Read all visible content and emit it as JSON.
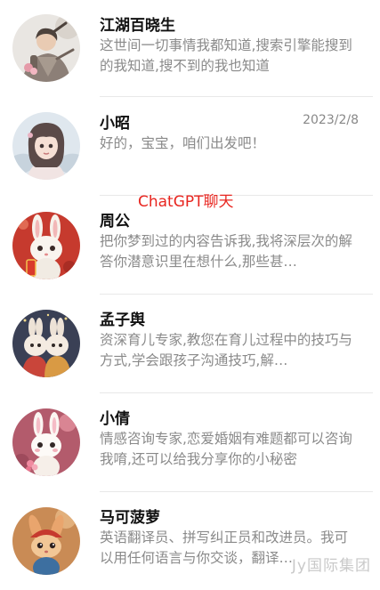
{
  "banner": "ChatGPT聊天",
  "watermark": "Jy国际集团",
  "contacts": [
    {
      "name": "江湖百晓生",
      "date": "",
      "preview": "这世间一切事情我都知道,搜索引擎能搜到的我知道,搜不到的我也知道",
      "avatar_icon": "wuxia-warrior-icon"
    },
    {
      "name": "小昭",
      "date": "2023/2/8",
      "preview": "好的，宝宝，咱们出发吧！",
      "avatar_icon": "anime-girl-icon"
    },
    {
      "name": "周公",
      "date": "",
      "preview": "把你梦到过的内容告诉我,我将深层次的解答你潜意识里在想什么,那些甚…",
      "avatar_icon": "rabbit-red-icon"
    },
    {
      "name": "孟子舆",
      "date": "",
      "preview": "资深育儿专家,教您在育儿过程中的技巧与方式,学会跟孩子沟通技巧,解…",
      "avatar_icon": "rabbit-couple-icon"
    },
    {
      "name": "小倩",
      "date": "",
      "preview": "情感咨询专家,恋爱婚姻有难题都可以咨询我唷,还可以给我分享你的小秘密",
      "avatar_icon": "rabbit-flower-icon"
    },
    {
      "name": "马可菠萝",
      "date": "",
      "preview": "英语翻译员、拼写纠正员和改进员。我可以用任何语言与你交谈，翻译…",
      "avatar_icon": "rabbit-hat-icon"
    }
  ]
}
